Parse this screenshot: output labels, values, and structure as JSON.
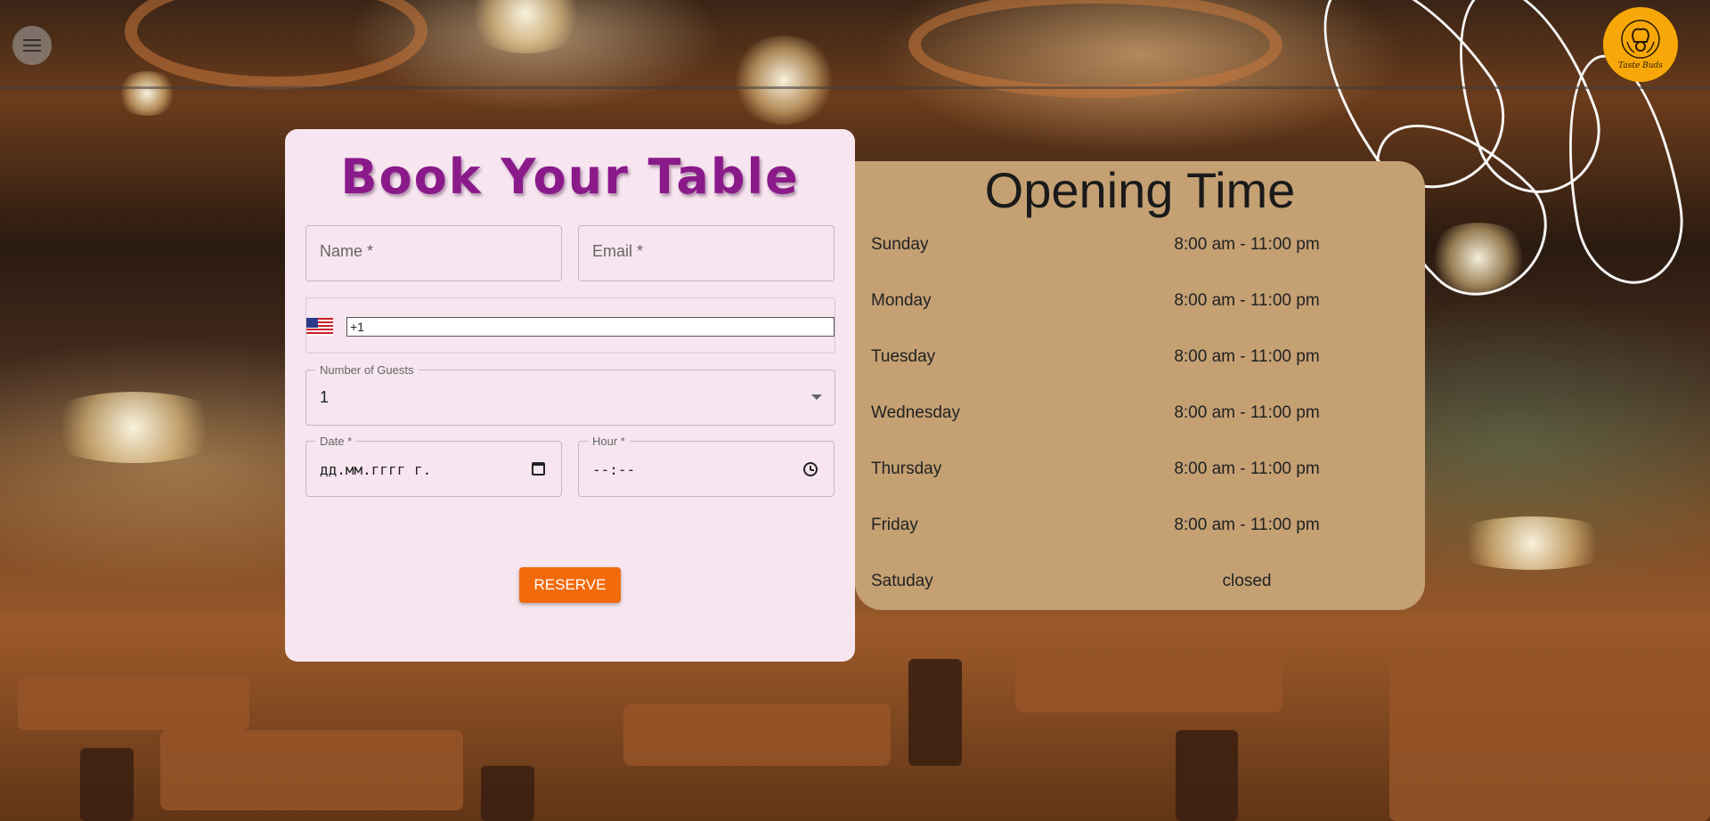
{
  "header": {
    "menu_icon": "hamburger-menu-icon",
    "logo_text": "Taste Buds",
    "logo_icon": "chef-logo-icon"
  },
  "booking": {
    "title": "Book Your Table",
    "name_placeholder": "Name *",
    "email_placeholder": "Email *",
    "phone_country_icon": "us-flag-icon",
    "phone_value": "+1",
    "guests_label": "Number of Guests",
    "guests_value": "1",
    "date_label": "Date *",
    "date_value": "дд.мм.гггг г.",
    "hour_label": "Hour *",
    "hour_value": "--:--",
    "reserve_label": "RESERVE",
    "accent_color": "#8a1a8a",
    "button_color": "#f26a0c"
  },
  "opening": {
    "title": "Opening Time",
    "rows": [
      {
        "day": "Sunday",
        "time": "8:00 am - 11:00 pm"
      },
      {
        "day": "Monday",
        "time": "8:00 am - 11:00 pm"
      },
      {
        "day": "Tuesday",
        "time": "8:00 am - 11:00 pm"
      },
      {
        "day": "Wednesday",
        "time": "8:00 am - 11:00 pm"
      },
      {
        "day": "Thursday",
        "time": "8:00 am - 11:00 pm"
      },
      {
        "day": "Friday",
        "time": "8:00 am - 11:00 pm"
      },
      {
        "day": "Satuday",
        "time": "closed"
      }
    ]
  }
}
